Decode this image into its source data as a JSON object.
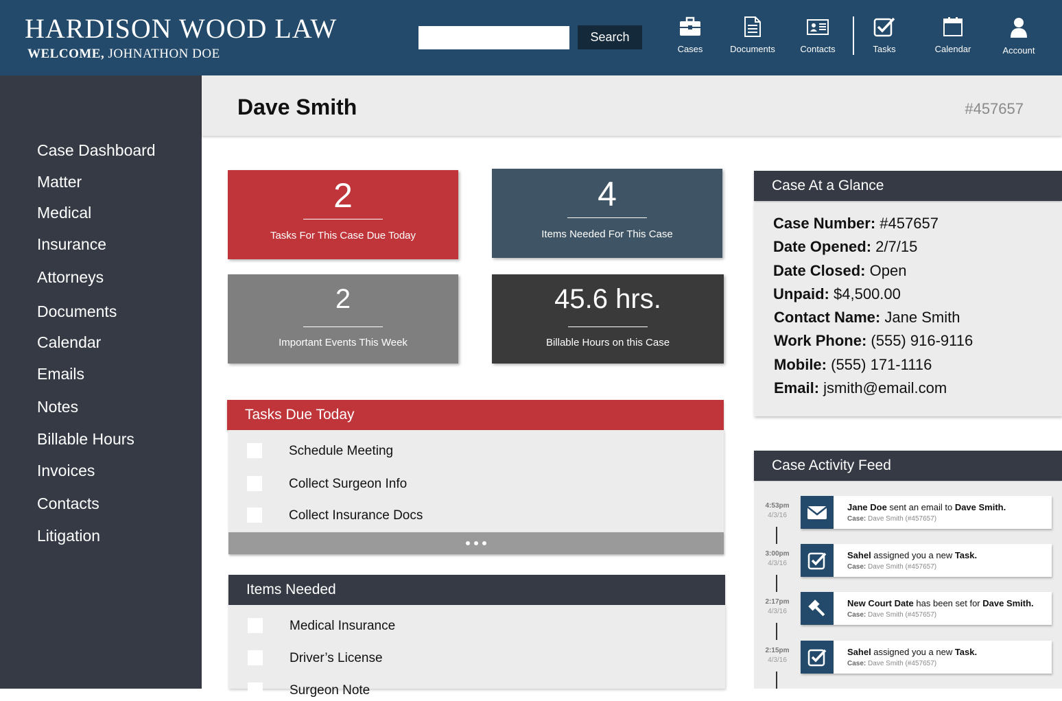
{
  "header": {
    "brand": "HARDISON WOOD LAW",
    "welcome_prefix": "WELCOME,",
    "welcome_name": "JOHNATHON DOE",
    "search_placeholder": "",
    "search_button": "Search",
    "nav": [
      {
        "label": "Cases",
        "icon": "briefcase-icon"
      },
      {
        "label": "Documents",
        "icon": "document-icon"
      },
      {
        "label": "Contacts",
        "icon": "contact-card-icon"
      },
      {
        "label": "Tasks",
        "icon": "checkbox-icon"
      },
      {
        "label": "Calendar",
        "icon": "calendar-icon"
      },
      {
        "label": "Account",
        "icon": "user-icon"
      }
    ]
  },
  "sidebar": {
    "items": [
      "Case Dashboard",
      "Matter",
      "Medical",
      "Insurance",
      "Attorneys",
      "Documents",
      "Calendar",
      "Emails",
      "Notes",
      "Billable Hours",
      "Invoices",
      "Contacts",
      "Litigation"
    ]
  },
  "page": {
    "client_name": "Dave Smith",
    "case_id": "#457657"
  },
  "stats": [
    {
      "value": "2",
      "label": "Tasks For This Case Due Today",
      "color": "#c0353a"
    },
    {
      "value": "4",
      "label": "Items Needed For This Case",
      "color": "#3f5565"
    },
    {
      "value": "2",
      "label": "Important Events This Week",
      "color": "#7f7f7f"
    },
    {
      "value": "45.6 hrs.",
      "label": "Billable Hours on this Case",
      "color": "#3a3a3a"
    }
  ],
  "tasks_panel": {
    "title": "Tasks Due Today",
    "items": [
      "Schedule Meeting",
      "Collect Surgeon Info",
      "Collect Insurance Docs"
    ]
  },
  "items_panel": {
    "title": "Items Needed",
    "items": [
      "Medical Insurance",
      "Driver’s License",
      "Surgeon Note"
    ]
  },
  "glance": {
    "title": "Case At a Glance",
    "rows": [
      {
        "label": "Case Number:",
        "value": "#457657"
      },
      {
        "label": "Date Opened:",
        "value": "2/7/15"
      },
      {
        "label": "Date Closed:",
        "value": "Open"
      },
      {
        "label": "Unpaid:",
        "value": "$4,500.00"
      },
      {
        "label": "Contact Name:",
        "value": "Jane Smith"
      },
      {
        "label": "Work Phone:",
        "value": "(555) 916-9116"
      },
      {
        "label": "Mobile:",
        "value": "(555) 171-1116"
      },
      {
        "label": "Email:",
        "value": "jsmith@email.com"
      }
    ]
  },
  "feed": {
    "title": "Case Activity Feed",
    "items": [
      {
        "time": "4:53pm",
        "date": "4/3/16",
        "icon": "envelope-icon",
        "a": "Jane Doe",
        "b": " sent an email to ",
        "c": "Dave Smith.",
        "case_label": "Case:",
        "case": "Dave Smith (#457657)"
      },
      {
        "time": "3:00pm",
        "date": "4/3/16",
        "icon": "checkbox-icon",
        "a": "Sahel",
        "b": " assigned you a new ",
        "c": "Task.",
        "case_label": "Case:",
        "case": "Dave Smith (#457657)"
      },
      {
        "time": "2:17pm",
        "date": "4/3/16",
        "icon": "gavel-icon",
        "a": "New Court Date",
        "b": " has been set for ",
        "c": "Dave Smith.",
        "case_label": "Case:",
        "case": "Dave Smith (#457657)"
      },
      {
        "time": "2:15pm",
        "date": "4/3/16",
        "icon": "checkbox-icon",
        "a": "Sahel",
        "b": " assigned you a new ",
        "c": "Task.",
        "case_label": "Case:",
        "case": "Dave Smith (#457657)"
      }
    ]
  },
  "colors": {
    "header": "#234a6a",
    "sidebar": "#353a44",
    "accent_red": "#c0353a",
    "panel_dark": "#353a44"
  }
}
